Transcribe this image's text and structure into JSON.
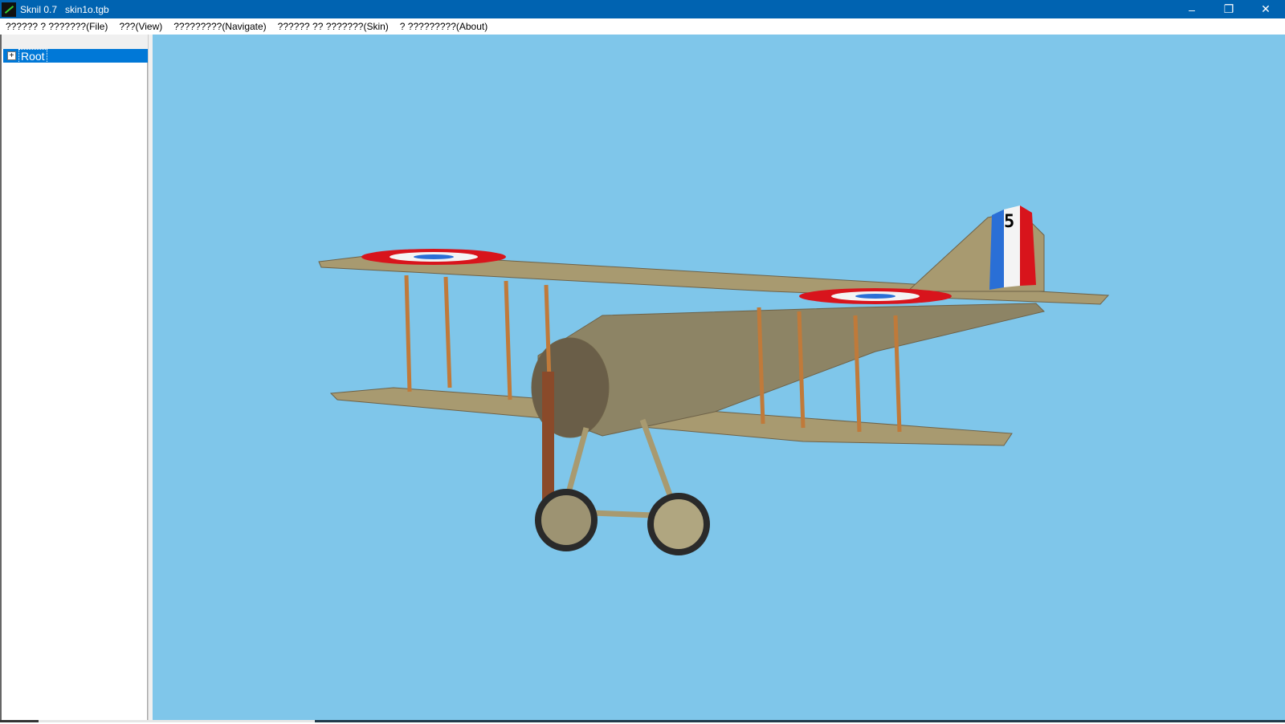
{
  "window": {
    "title": "Sknil 0.7   skin1o.tgb",
    "minimize": "–",
    "restore": "❐",
    "close": "✕"
  },
  "menu": [
    "?????? ? ???????(File)",
    "???(View)",
    "?????????(Navigate)",
    "?????? ?? ???????(Skin)",
    "? ?????????(About)"
  ],
  "tree": {
    "expander": "+",
    "root": "Root"
  },
  "aircraft": {
    "tail_number": "5",
    "colors": {
      "blue": "#2a6fd6",
      "white": "#f4f4f4",
      "red": "#d8141c",
      "sky": "#7fc6ea"
    }
  }
}
